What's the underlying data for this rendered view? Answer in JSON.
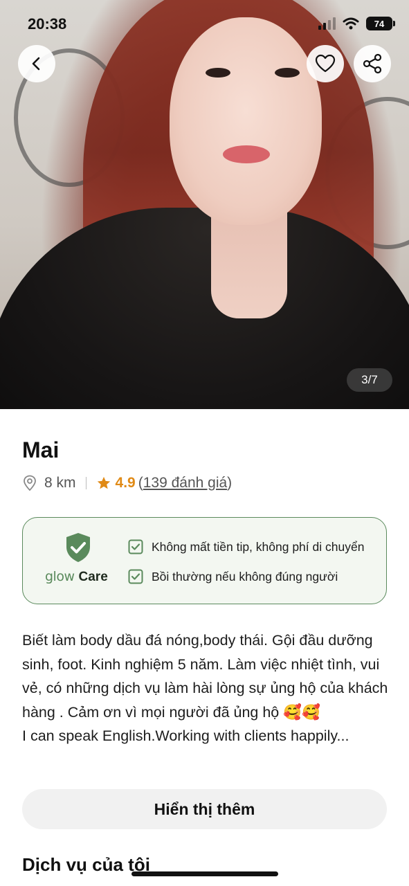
{
  "status_bar": {
    "time": "20:38",
    "battery": "74"
  },
  "gallery": {
    "counter": "3/7"
  },
  "icons": {
    "back": "chevron-left-icon",
    "favorite": "heart-icon",
    "share": "share-icon",
    "location": "location-pin-icon",
    "star": "star-icon",
    "check": "check-square-icon",
    "shield": "shield-check-icon"
  },
  "profile": {
    "name": "Mai",
    "distance": "8 km",
    "rating": "4.9",
    "reviews_open": "(",
    "reviews": "139 đánh giá",
    "reviews_close": ")"
  },
  "care": {
    "brand_glow": "glow",
    "brand_care": "Care",
    "items": [
      "Không mất tiền tip, không phí di chuyển",
      "Bồi thường nếu không đúng người"
    ]
  },
  "description": {
    "lines": [
      "Biết làm body dầu đá nóng,body thái. Gội đầu dưỡng sinh, foot. Kinh nghiệm 5 năm. Làm việc nhiệt tình, vui vẻ, có những dịch vụ làm hài lòng sự ủng hộ của khách hàng . Cảm ơn vì mọi người đã ủng hộ 🥰🥰",
      "I can speak English.Working with clients happily..."
    ]
  },
  "actions": {
    "show_more": "Hiển thị thêm"
  },
  "sections": {
    "my_services": "Dịch vụ của tôi"
  },
  "colors": {
    "accent_green": "#5a8a5c",
    "rating_orange": "#e08a16",
    "care_bg": "#f3f7f1"
  }
}
